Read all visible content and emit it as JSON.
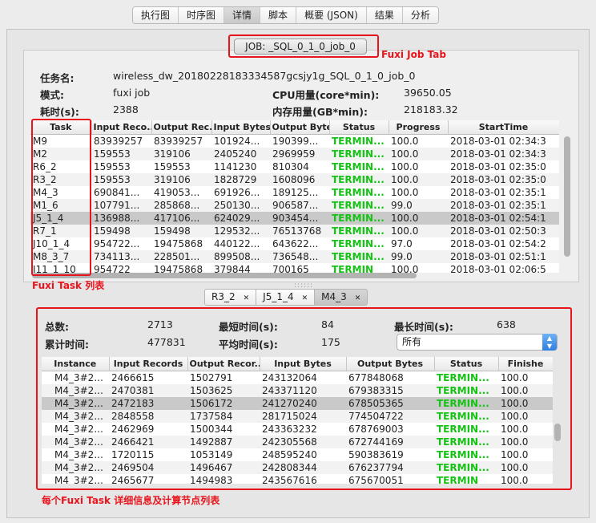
{
  "tabs": [
    "执行图",
    "时序图",
    "详情",
    "脚本",
    "概要 (JSON)",
    "结果",
    "分析"
  ],
  "job_tab": "JOB: _SQL_0_1_0_job_0",
  "annotations": {
    "job_tab": "Fuxi Job Tab",
    "task_list": "Fuxi Task 列表",
    "detail": "每个Fuxi Task 详细信息及计算节点列表"
  },
  "job_info": {
    "task_name_label": "任务名:",
    "task_name": "wireless_dw_20180228183334587gcsjy1g_SQL_0_1_0_job_0",
    "mode_label": "模式:",
    "mode": "fuxi job",
    "cpu_label": "CPU用量(core*min):",
    "cpu": "39650.05",
    "time_label": "耗时(s):",
    "time": "2388",
    "mem_label": "内存用量(GB*min):",
    "mem": "218183.32"
  },
  "task_table": {
    "columns": [
      "Task",
      "Input Reco...",
      "Output Rec...",
      "Input Bytes",
      "Output Bytes",
      "Status",
      "Progress",
      "StartTime"
    ],
    "rows": [
      [
        "M9",
        "83939257",
        "83939257",
        "101924...",
        "190399...",
        "TERMIN...",
        "100.0",
        "2018-03-01 02:34:3"
      ],
      [
        "M2",
        "159553",
        "319106",
        "2405240",
        "2969959",
        "TERMIN...",
        "100.0",
        "2018-03-01 02:34:3"
      ],
      [
        "R6_2",
        "159553",
        "159553",
        "1141230",
        "810304",
        "TERMIN...",
        "100.0",
        "2018-03-01 02:35:0"
      ],
      [
        "R3_2",
        "159553",
        "319106",
        "1828729",
        "1608096",
        "TERMIN...",
        "100.0",
        "2018-03-01 02:35:0"
      ],
      [
        "M4_3",
        "690841...",
        "419053...",
        "691926...",
        "189125...",
        "TERMIN...",
        "100.0",
        "2018-03-01 02:35:1"
      ],
      [
        "M1_6",
        "107791...",
        "285868...",
        "250130...",
        "906587...",
        "TERMIN...",
        "99.0",
        "2018-03-01 02:35:1"
      ],
      [
        "J5_1_4",
        "136988...",
        "417106...",
        "624029...",
        "903454...",
        "TERMIN...",
        "100.0",
        "2018-03-01 02:54:1"
      ],
      [
        "R7_1",
        "159498",
        "159498",
        "129532...",
        "76513768",
        "TERMIN...",
        "100.0",
        "2018-03-01 02:50:3"
      ],
      [
        "J10_1_4",
        "954722...",
        "19475868",
        "440122...",
        "643622...",
        "TERMIN...",
        "97.0",
        "2018-03-01 02:54:2"
      ],
      [
        "M8_3_7",
        "734113...",
        "228501...",
        "899508...",
        "736548...",
        "TERMIN...",
        "99.0",
        "2018-03-01 02:51:1"
      ],
      [
        "J11_1_10",
        "954722",
        "19475868",
        "379844",
        "700165",
        "TERMIN",
        "100.0",
        "2018-03-01 02:06:5"
      ]
    ],
    "selected_row": 6
  },
  "sub_tabs": [
    "R3_2",
    "J5_1_4",
    "M4_3"
  ],
  "stats": {
    "total_label": "总数:",
    "total": "2713",
    "min_label": "最短时间(s):",
    "min": "84",
    "max_label": "最长时间(s):",
    "max": "638",
    "cum_label": "累计时间:",
    "cum": "477831",
    "avg_label": "平均时间(s):",
    "avg": "175",
    "filter": "所有"
  },
  "instance_table": {
    "columns": [
      "Instance",
      "Input Records",
      "Output Recor...",
      "Input Bytes",
      "Output Bytes",
      "Status",
      "Finishe"
    ],
    "rows": [
      [
        "M4_3#2...",
        "2466615",
        "1502791",
        "243132064",
        "677848068",
        "TERMIN...",
        "100.0"
      ],
      [
        "M4_3#2...",
        "2470381",
        "1503625",
        "243371120",
        "679383315",
        "TERMIN...",
        "100.0"
      ],
      [
        "M4_3#2...",
        "2472183",
        "1506172",
        "241270240",
        "678505365",
        "TERMIN...",
        "100.0"
      ],
      [
        "M4_3#2...",
        "2848558",
        "1737584",
        "281715024",
        "774504722",
        "TERMIN...",
        "100.0"
      ],
      [
        "M4_3#2...",
        "2462969",
        "1500344",
        "243363232",
        "678769003",
        "TERMIN...",
        "100.0"
      ],
      [
        "M4_3#2...",
        "2466421",
        "1492887",
        "242305568",
        "672744169",
        "TERMIN...",
        "100.0"
      ],
      [
        "M4_3#2...",
        "1720115",
        "1053149",
        "248595240",
        "590383619",
        "TERMIN...",
        "100.0"
      ],
      [
        "M4_3#2...",
        "2469504",
        "1496467",
        "242808344",
        "676237794",
        "TERMIN...",
        "100.0"
      ],
      [
        "M4_3#2...",
        "2465677",
        "1494983",
        "243567616",
        "675670051",
        "TERMIN",
        "100.0"
      ]
    ],
    "selected_row": 2
  },
  "colors": {
    "highlight_red": "#e8141c",
    "status_green": "#14c314",
    "select_accent": "#2f7fe0"
  }
}
